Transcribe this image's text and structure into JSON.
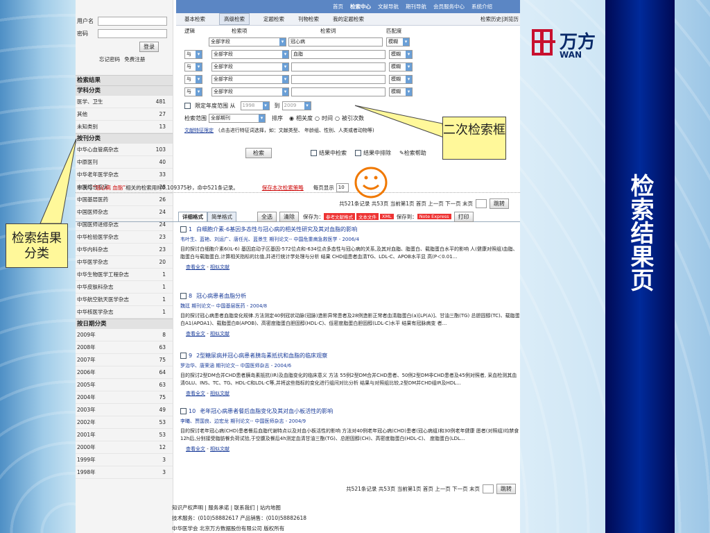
{
  "login": {
    "user_label": "用户名",
    "pass_label": "密码",
    "login_btn": "登录",
    "forgot": "忘记密码",
    "register": "免费注册"
  },
  "left": {
    "results_title": "检索结果",
    "subject_title": "学科分类",
    "subjects": [
      [
        "医学、卫生",
        "481"
      ],
      [
        "其他",
        "27"
      ],
      [
        "未知类别",
        "13"
      ]
    ],
    "journal_title": "按刊分类",
    "journals": [
      [
        "中华心血管病杂志",
        "103"
      ],
      [
        "中原医刊",
        "40"
      ],
      [
        "中华老年医学杂志",
        "33"
      ],
      [
        "中国综合临床",
        "28"
      ],
      [
        "中国基层医药",
        "26"
      ],
      [
        "中国医师杂志",
        "24"
      ],
      [
        "中国医师进修杂志",
        "24"
      ],
      [
        "中华检验医学杂志",
        "23"
      ],
      [
        "中华内科杂志",
        "23"
      ],
      [
        "中华医学杂志",
        "20"
      ],
      [
        "中华生物医学工程杂志",
        "1"
      ],
      [
        "中华皮肤科杂志",
        "1"
      ],
      [
        "中华航空航天医学杂志",
        "1"
      ],
      [
        "中华核医学杂志",
        "1"
      ]
    ],
    "year_title": "按日期分类",
    "years": [
      [
        "2009年",
        "8"
      ],
      [
        "2008年",
        "63"
      ],
      [
        "2007年",
        "75"
      ],
      [
        "2006年",
        "64"
      ],
      [
        "2005年",
        "63"
      ],
      [
        "2004年",
        "75"
      ],
      [
        "2003年",
        "49"
      ],
      [
        "2002年",
        "53"
      ],
      [
        "2001年",
        "53"
      ],
      [
        "2000年",
        "12"
      ],
      [
        "1999年",
        "3"
      ],
      [
        "1998年",
        "3"
      ]
    ]
  },
  "topnav": [
    "首页",
    "检索中心",
    "文献导航",
    "期刊导航",
    "会员服务中心",
    "系统介绍"
  ],
  "tabs": [
    "基本检索",
    "高级检索",
    "定题检索",
    "刊物检索",
    "我的定题检索"
  ],
  "history": "检索历史|浏览历",
  "query_headers": [
    "逻辑",
    "检索项",
    "检索词",
    "匹配度"
  ],
  "query_rows": [
    {
      "logic": "",
      "field": "全部字段",
      "term": "冠心病",
      "match": "模糊"
    },
    {
      "logic": "与",
      "field": "全部字段",
      "term": "血脂",
      "match": "模糊"
    },
    {
      "logic": "与",
      "field": "全部字段",
      "term": "",
      "match": "模糊"
    },
    {
      "logic": "与",
      "field": "全部字段",
      "term": "",
      "match": "模糊"
    },
    {
      "logic": "与",
      "field": "全部字段",
      "term": "",
      "match": "模糊"
    }
  ],
  "year_limit": {
    "label": "限定年度范围 从",
    "from": "1998",
    "to_label": "到",
    "to": "2009"
  },
  "scope": {
    "label": "检索范围",
    "value": "全部期刊",
    "sort_label": "排序",
    "opt1": "相关度",
    "opt2": "时间",
    "opt3": "被引次数"
  },
  "feature": {
    "link": "文献特征限定",
    "hint": "(点击进行特征词选择，如：文献类型、 年龄组、性别、人类或者动物等)"
  },
  "actions": {
    "search": "检索",
    "in_results": "结果中检索",
    "exclude": "结果中排除",
    "help": "检索帮助"
  },
  "summary": {
    "prefix": "本次与",
    "keyword": "“冠心病 血脂”",
    "suffix": "相关的检索用时0.109375秒，命中521条记录。",
    "save": "保存本次检索策略",
    "perpage": "每页显示",
    "perpage_val": "10"
  },
  "pager": {
    "text": "共521条记录 共53页 当前第1页 首页 上一页 下一页 末页",
    "jump": "跳转"
  },
  "format": {
    "detail": "详细格式",
    "simple": "简单格式",
    "select_all": "全选",
    "clear": "清除",
    "save_as": "保存为：",
    "fmt1": "参考文献格式",
    "fmt2": "文本文件",
    "fmt3": "XML",
    "save_to": "保存到：",
    "fmt4": "Note Express",
    "print": "打印"
  },
  "records": [
    {
      "n": "1",
      "title": "白细胞介素-6基因多态性与冠心病的相关性研究及其对血脂的影响",
      "meta": "韦叶生、蓝艳、刘运广、唐任光、蓝景生 期刊论文-- 中国危重病急救医学 - 2006/4",
      "abs": "目的探讨白细胞介素6(IL-6) 基因启动子区基因-572位点和-634位点多态性与冠心病的关系,及其对血脂、脂蛋白、载脂蛋白水平的影响 人(健康对照组)血脂、脂蛋白与载脂蛋白,计算相关指标的比值,并进行统计学处理与分析 结果 CHD组患者血清TG、LDL-C、APOB水平显 高(P＜0.01..."
    },
    {
      "n": "8",
      "title": "冠心病患者血脂分析",
      "meta": "魏廷 期刊论文-- 中国基层医药 - 2004/8",
      "abs": "目的探讨冠心病患者血脂变化规律.方法测定40例冠状动脉(冠脉)造影异常患者及28例造影正常者血清脂蛋白(a)[LP(A)]、甘油三酯(TG) 总胆固醇(TC)、载脂蛋白A1(APOA1)、载脂蛋白B(APOB)、高密度脂蛋白胆固醇(HDL-C)、低密度脂蛋白胆固醇(LDL-C)水平 结果有冠脉病变 者..."
    },
    {
      "n": "9",
      "title": "2型糖尿病并冠心病患者胰岛素抵抗和血脂的临床观察",
      "meta": "罗治华、唐荣涵 期刊论文-- 中国医师杂志 - 2004/6",
      "abs": "目的探讨2型DM合并CHD患者胰岛素抵抗(IR)及血脂变化的临床意义 方法 55例2型DM合并CHD患者、50例2型DM非CHD患者及45例对照者, 采血检测其血清GLU、INS、TC、TG、HDL-C和LDL-C等,并将这些指标的变化进行组间对比分析 结果与对照组比较,2型DM并CHD组IR及HDL..."
    },
    {
      "n": "10",
      "title": "老年冠心病患者餐后血脂变化及其对血小板活性的影响",
      "meta": "李曦、贾国良、边宏龙 期刊论文-- 中国医师杂志 - 2004/9",
      "abs": "目的探讨老年冠心病(CHD)患者餐后血脂代谢特点以及对血小板活性的影响 方法对40例老年冠心病(CHD)患者(冠心病组)和30例老年健康 愿者(对照组)均禁食12h后,分别接受脂肪餐负荷试验,于空腹及餐后4h测定血清甘油三酯(TG)、总胆固醇(CH)、高密度脂蛋白(HDL-C)、 度脂蛋白(LDL..."
    }
  ],
  "record_links": {
    "full": "查看全文",
    "similar": "相似文献"
  },
  "footer": {
    "l1": "知识产权声明 | 服务承诺 | 联系我们 | 站内地图",
    "l2": "技术服务：(010)58882617 产品销售：(010)58882618",
    "l3": "中华医学会 北京万方数据股份有限公司 版权所有"
  },
  "callouts": {
    "left": "检索结果分类",
    "right": "二次检索框"
  },
  "logo": {
    "text": "万方",
    "sub": "WAN"
  },
  "side_title": "检索结果页"
}
